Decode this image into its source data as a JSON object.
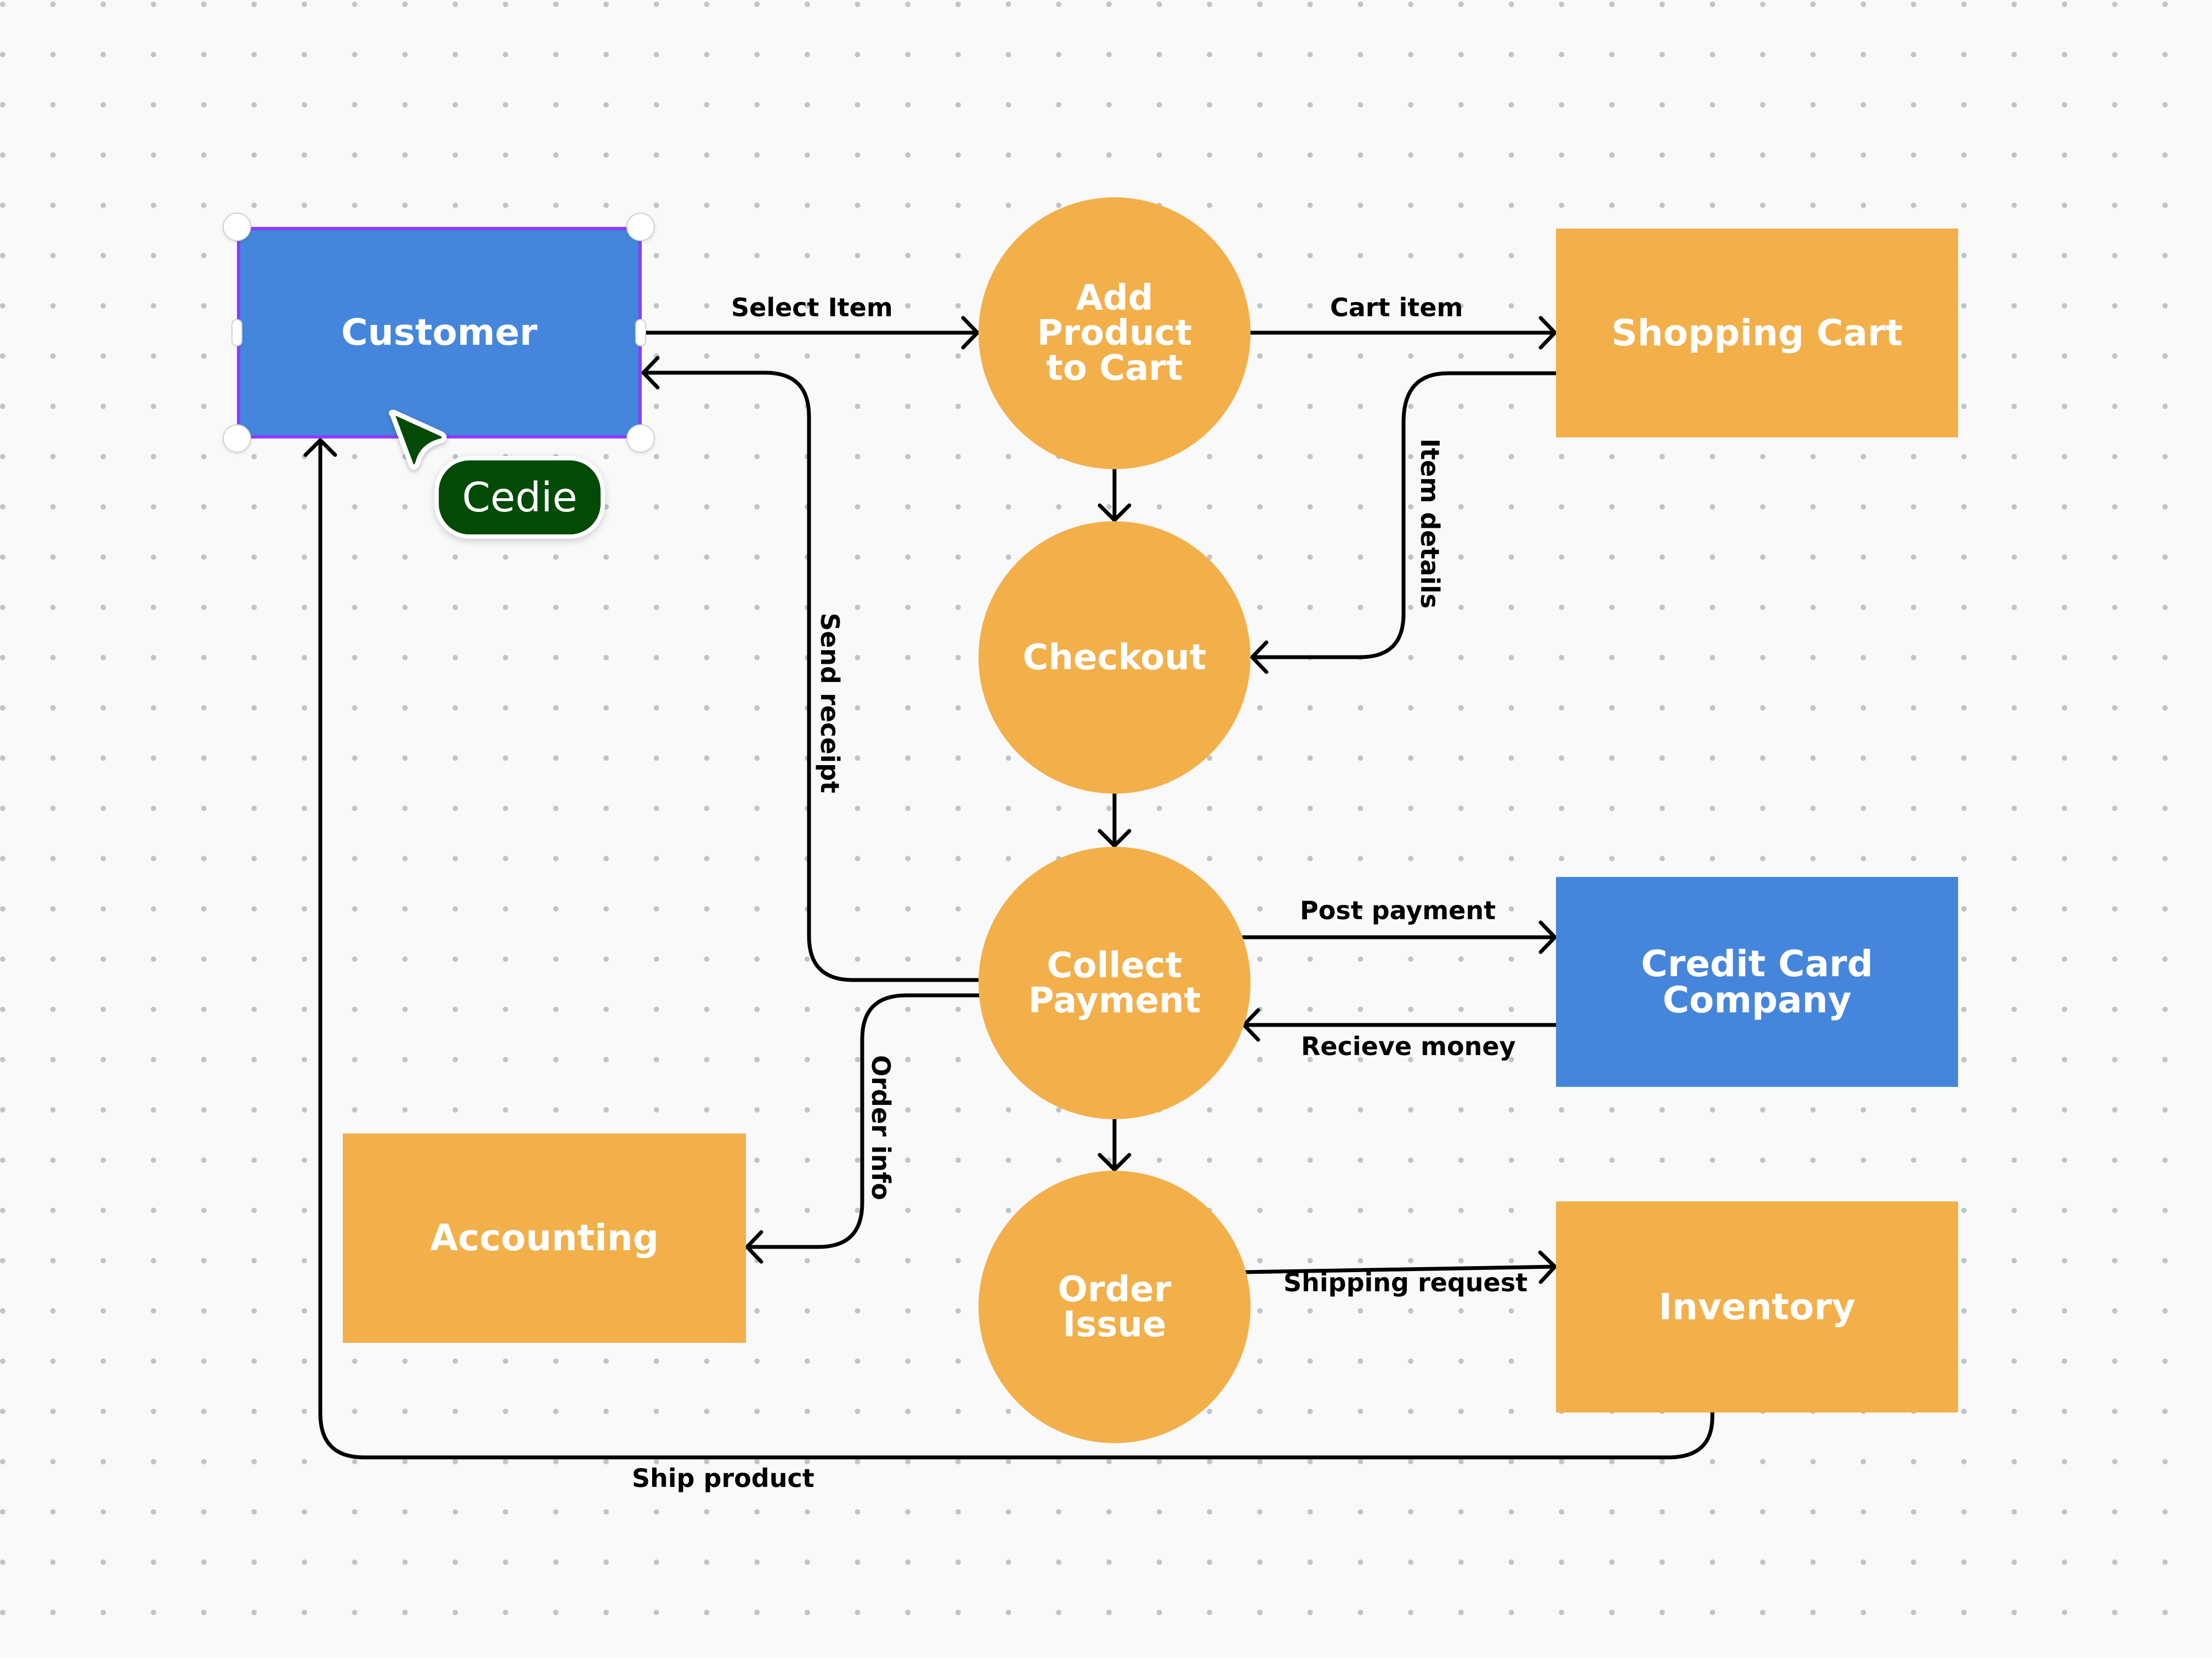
{
  "diagram": {
    "type": "data-flow-diagram",
    "colors": {
      "background": "#f9f9f9",
      "grid_dot": "#bec4c7",
      "entity_blue": "#4586dc",
      "entity_orange": "#f2af4a",
      "process_orange": "#f2af4a",
      "connector": "#000000",
      "selection": "#8b3dff",
      "collaborator": "#024a06"
    },
    "nodes": [
      {
        "id": "customer",
        "label": "Customer",
        "shape": "rectangle",
        "color": "blue",
        "selected": true
      },
      {
        "id": "shopping-cart",
        "label": "Shopping Cart",
        "shape": "rectangle",
        "color": "orange"
      },
      {
        "id": "credit-card-company",
        "label": "Credit Card\nCompany",
        "shape": "rectangle",
        "color": "blue"
      },
      {
        "id": "inventory",
        "label": "Inventory",
        "shape": "rectangle",
        "color": "orange"
      },
      {
        "id": "accounting",
        "label": "Accounting",
        "shape": "rectangle",
        "color": "orange"
      },
      {
        "id": "add-product",
        "label": "Add\nProduct\nto Cart",
        "shape": "circle",
        "color": "orange"
      },
      {
        "id": "checkout",
        "label": "Checkout",
        "shape": "circle",
        "color": "orange"
      },
      {
        "id": "collect-payment",
        "label": "Collect\nPayment",
        "shape": "circle",
        "color": "orange"
      },
      {
        "id": "order-issue",
        "label": "Order\nIssue",
        "shape": "circle",
        "color": "orange"
      }
    ],
    "flows": [
      {
        "id": "select-item",
        "label": "Select Item",
        "from": "customer",
        "to": "add-product"
      },
      {
        "id": "cart-item",
        "label": "Cart item",
        "from": "add-product",
        "to": "shopping-cart"
      },
      {
        "id": "add-to-checkout",
        "label": "",
        "from": "add-product",
        "to": "checkout"
      },
      {
        "id": "item-details",
        "label": "Item details",
        "from": "shopping-cart",
        "to": "checkout"
      },
      {
        "id": "checkout-to-payment",
        "label": "",
        "from": "checkout",
        "to": "collect-payment"
      },
      {
        "id": "send-receipt",
        "label": "Send receipt",
        "from": "collect-payment",
        "to": "customer"
      },
      {
        "id": "post-payment",
        "label": "Post payment",
        "from": "collect-payment",
        "to": "credit-card-company"
      },
      {
        "id": "recieve-money",
        "label": "Recieve money",
        "from": "credit-card-company",
        "to": "collect-payment"
      },
      {
        "id": "order-info",
        "label": "Order info",
        "from": "collect-payment",
        "to": "accounting"
      },
      {
        "id": "payment-to-order",
        "label": "",
        "from": "collect-payment",
        "to": "order-issue"
      },
      {
        "id": "shipping-request",
        "label": "Shipping request",
        "from": "order-issue",
        "to": "inventory"
      },
      {
        "id": "ship-product",
        "label": "Ship product",
        "from": "inventory",
        "to": "customer"
      }
    ]
  },
  "collaborator": {
    "name": "Cedie",
    "cursor_icon": "pointer-cursor-icon",
    "color": "#024a06"
  }
}
